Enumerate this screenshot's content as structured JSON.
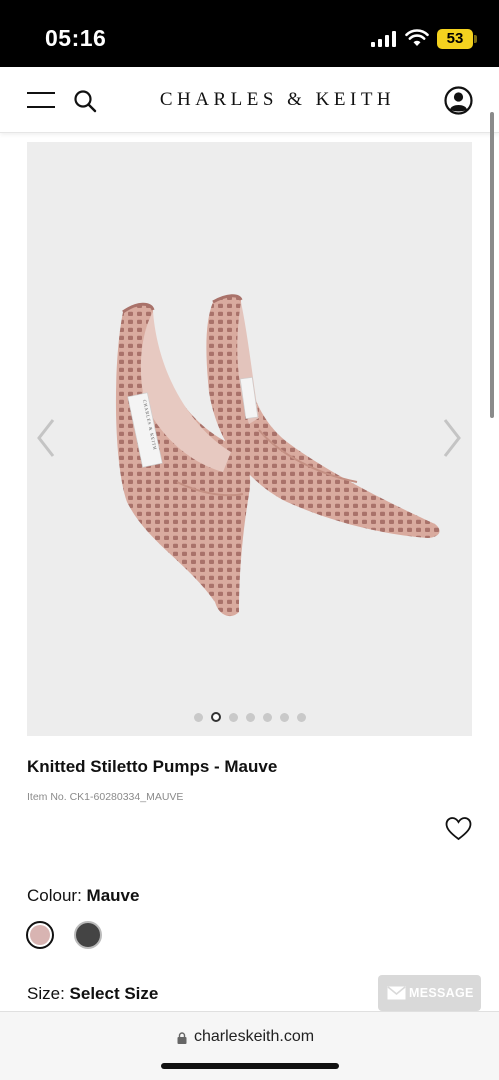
{
  "status_bar": {
    "time": "05:16",
    "battery": "53"
  },
  "header": {
    "brand": "CHARLES & KEITH"
  },
  "product": {
    "title": "Knitted Stiletto Pumps - Mauve",
    "item_no": "Item No. CK1-60280334_MAUVE",
    "colour_label": "Colour:",
    "colour_value": "Mauve",
    "size_label": "Size:",
    "size_value": "Select Size",
    "carousel": {
      "total": 7,
      "active_index": 1
    },
    "insole_logo": "CHARLES & KEITH",
    "swatches": [
      {
        "name": "Mauve",
        "color": "#d8b4b2",
        "selected": true
      },
      {
        "name": "Dark",
        "color": "#444444",
        "selected": false
      }
    ]
  },
  "chat": {
    "message_label": "MESSAGE"
  },
  "browser": {
    "url": "charleskeith.com"
  },
  "colors": {
    "image_bg": "#ededed",
    "shoe": "#d9ab9f",
    "mauve_swatch": "#d8b4b2"
  }
}
